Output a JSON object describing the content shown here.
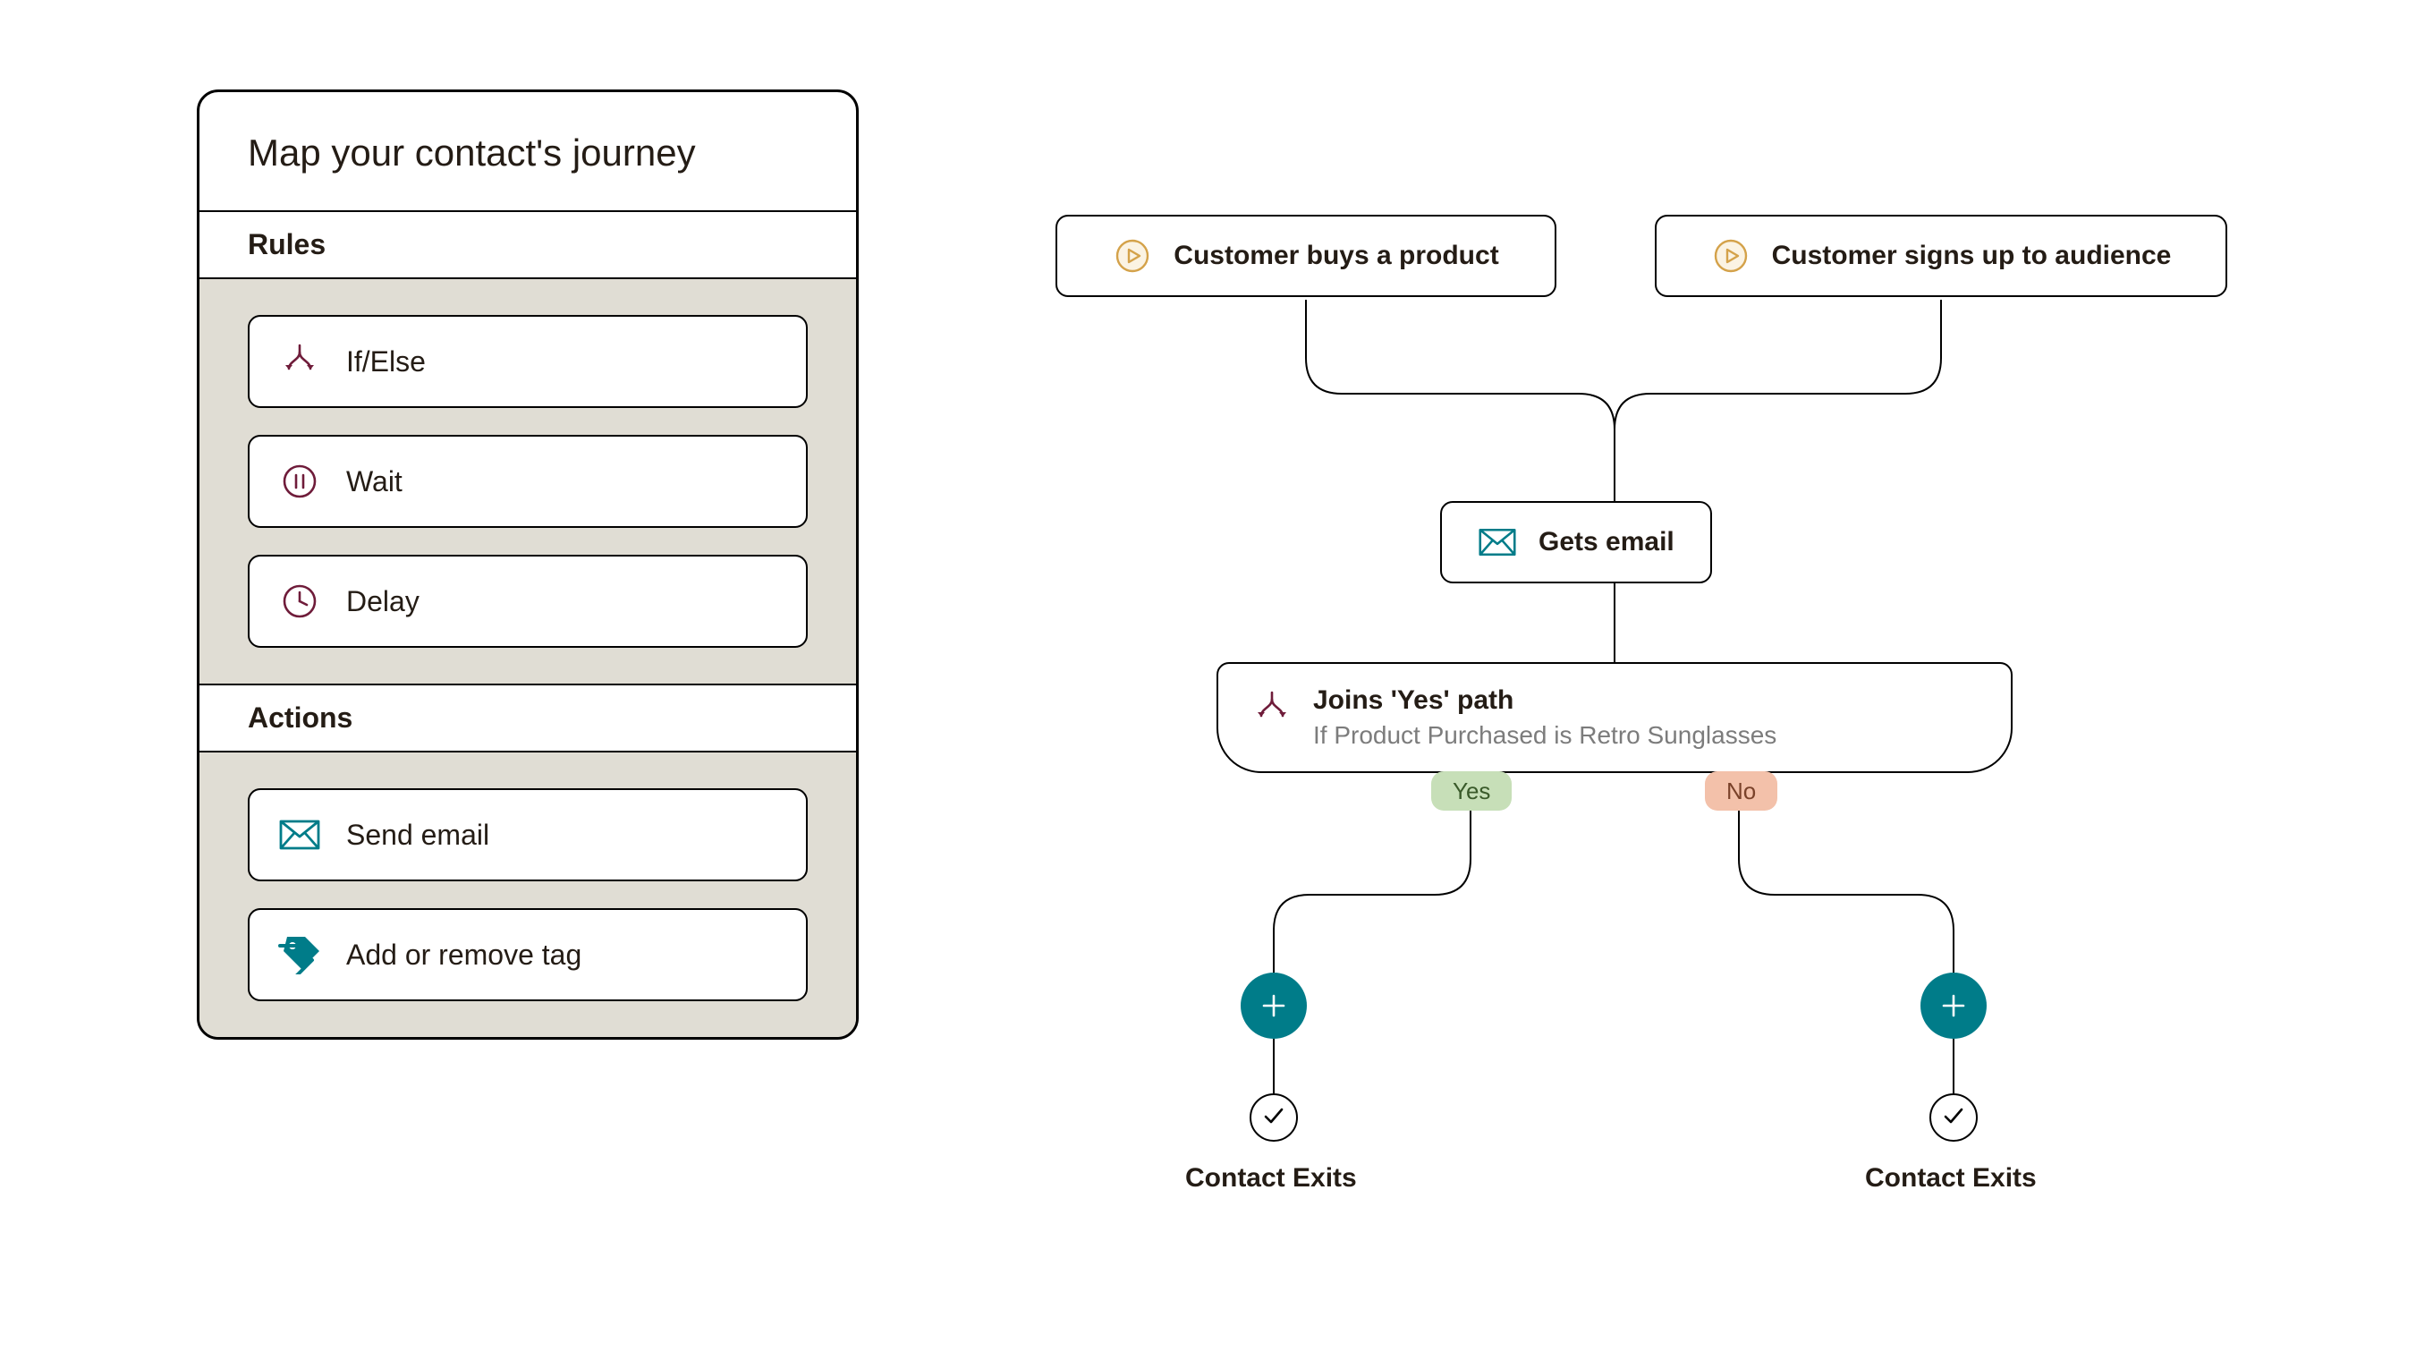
{
  "sidebar": {
    "title": "Map your contact's journey",
    "sections": [
      {
        "header": "Rules",
        "items": [
          {
            "icon": "branch",
            "label": "If/Else"
          },
          {
            "icon": "pause",
            "label": "Wait"
          },
          {
            "icon": "clock",
            "label": "Delay"
          }
        ]
      },
      {
        "header": "Actions",
        "items": [
          {
            "icon": "mail",
            "label": "Send email"
          },
          {
            "icon": "tag",
            "label": "Add or remove tag"
          }
        ]
      }
    ]
  },
  "flow": {
    "triggers": [
      {
        "label": "Customer buys a product"
      },
      {
        "label": "Customer signs up to audience"
      }
    ],
    "email_node": {
      "label": "Gets email"
    },
    "branch_node": {
      "title": "Joins 'Yes' path",
      "subtitle": "If Product Purchased is Retro Sunglasses",
      "yes_label": "Yes",
      "no_label": "No"
    },
    "exit_label": "Contact Exits"
  }
}
